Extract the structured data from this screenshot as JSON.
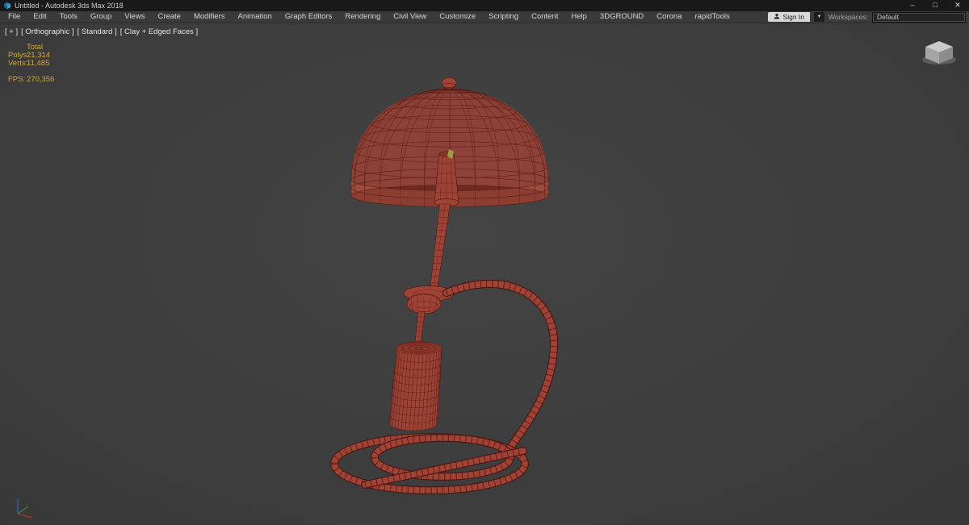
{
  "window": {
    "title": "Untitled - Autodesk 3ds Max 2018",
    "controls": {
      "minimize": "–",
      "maximize": "□",
      "close": "✕"
    }
  },
  "menu_bar": {
    "items": [
      "File",
      "Edit",
      "Tools",
      "Group",
      "Views",
      "Create",
      "Modifiers",
      "Animation",
      "Graph Editors",
      "Rendering",
      "Civil View",
      "Customize",
      "Scripting",
      "Content",
      "Help",
      "3DGROUND",
      "Corona",
      "rapidTools"
    ],
    "sign_in_label": "Sign In",
    "sign_in_caret": "▼",
    "workspaces_label": "Workspaces:",
    "workspace_value": "Default"
  },
  "viewport": {
    "label": {
      "plus": "[ + ]",
      "view": "[ Orthographic ]",
      "style": "[ Standard ]",
      "shading": "[ Clay + Edged Faces ]"
    },
    "stats": {
      "total": "Total",
      "polys_label": "Polys:",
      "polys_value": "21,314",
      "verts_label": "Verts:",
      "verts_value": "11,485",
      "fps_label": "FPS:",
      "fps_value": "270,356"
    },
    "colors": {
      "background": "#3e3e3e",
      "wire": "#5a1a14",
      "clay": "#9e4336",
      "clay_light": "#b25a47",
      "clay_dark": "#63201a",
      "stats_text": "#cfa743",
      "label_text": "#e4e4e4",
      "glint": "#a3a84a",
      "axis_x": "#b23a35",
      "axis_y": "#3f8f3f",
      "axis_z": "#3b63c9"
    }
  }
}
